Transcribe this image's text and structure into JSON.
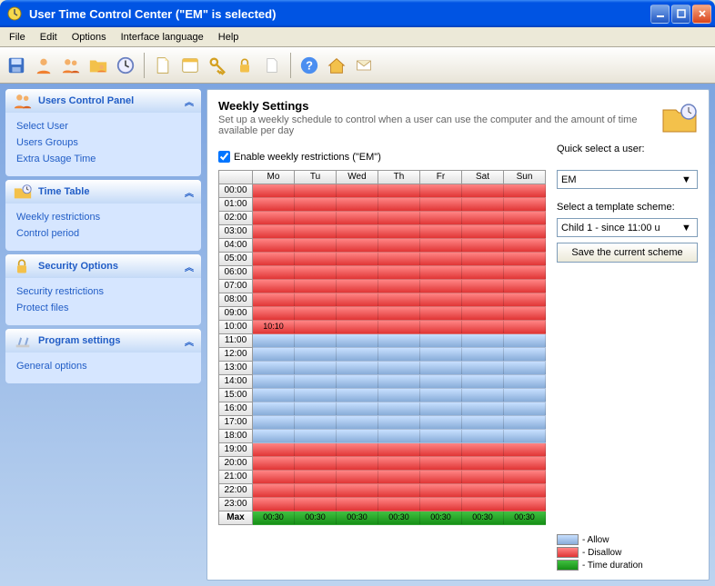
{
  "window": {
    "title": "User Time Control Center (\"EM\" is selected)"
  },
  "menus": [
    "File",
    "Edit",
    "Options",
    "Interface language",
    "Help"
  ],
  "toolbar_icons": [
    "save-icon",
    "user-icon",
    "users-icon",
    "folder-user-icon",
    "clock-icon",
    "page-icon",
    "browser-icon",
    "keys-icon",
    "lock-icon",
    "document-icon",
    "help-icon",
    "home-icon",
    "mail-icon"
  ],
  "sidebar": {
    "panels": [
      {
        "title": "Users Control Panel",
        "icon": "users-panel-icon",
        "items": [
          "Select User",
          "Users Groups",
          "Extra Usage Time"
        ]
      },
      {
        "title": "Time Table",
        "icon": "timetable-icon",
        "items": [
          "Weekly restrictions",
          "Control period"
        ]
      },
      {
        "title": "Security Options",
        "icon": "security-icon",
        "items": [
          "Security restrictions",
          "Protect files"
        ]
      },
      {
        "title": "Program settings",
        "icon": "settings-icon",
        "items": [
          "General options"
        ]
      }
    ]
  },
  "main": {
    "title": "Weekly Settings",
    "subtitle": "Set up a weekly schedule to control when a user can use the computer and the amount of time available per day",
    "enable_label": "Enable weekly restrictions (\"EM\")",
    "enable_checked": true,
    "quick_select_label": "Quick select a user:",
    "quick_select_value": "EM",
    "template_label": "Select a template scheme:",
    "template_value": "Child 1  - since 11:00 u",
    "save_scheme": "Save the current scheme",
    "days": [
      "Mo",
      "Tu",
      "Wed",
      "Th",
      "Fr",
      "Sat",
      "Sun"
    ],
    "hours": [
      "00:00",
      "01:00",
      "02:00",
      "03:00",
      "04:00",
      "05:00",
      "06:00",
      "07:00",
      "08:00",
      "09:00",
      "10:00",
      "11:00",
      "12:00",
      "13:00",
      "14:00",
      "15:00",
      "16:00",
      "17:00",
      "18:00",
      "19:00",
      "20:00",
      "21:00",
      "22:00",
      "23:00"
    ],
    "cell_note": {
      "row": 10,
      "col": 0,
      "text": "10:10"
    },
    "states": [
      "DDDDDDD",
      "DDDDDDD",
      "DDDDDDD",
      "DDDDDDD",
      "DDDDDDD",
      "DDDDDDD",
      "DDDDDDD",
      "DDDDDDD",
      "DDDDDDD",
      "DDDDDDD",
      "DDDDDDD",
      "AAAAAAA",
      "AAAAAAA",
      "AAAAAAA",
      "AAAAAAA",
      "AAAAAAA",
      "AAAAAAA",
      "AAAAAAA",
      "AAAAAAA",
      "DDDDDDD",
      "DDDDDDD",
      "DDDDDDD",
      "DDDDDDD",
      "DDDDDDD"
    ],
    "max_label": "Max",
    "max_values": [
      "00:30",
      "00:30",
      "00:30",
      "00:30",
      "00:30",
      "00:30",
      "00:30"
    ],
    "legend": {
      "allow": "- Allow",
      "disallow": "- Disallow",
      "duration": "- Time duration"
    }
  }
}
